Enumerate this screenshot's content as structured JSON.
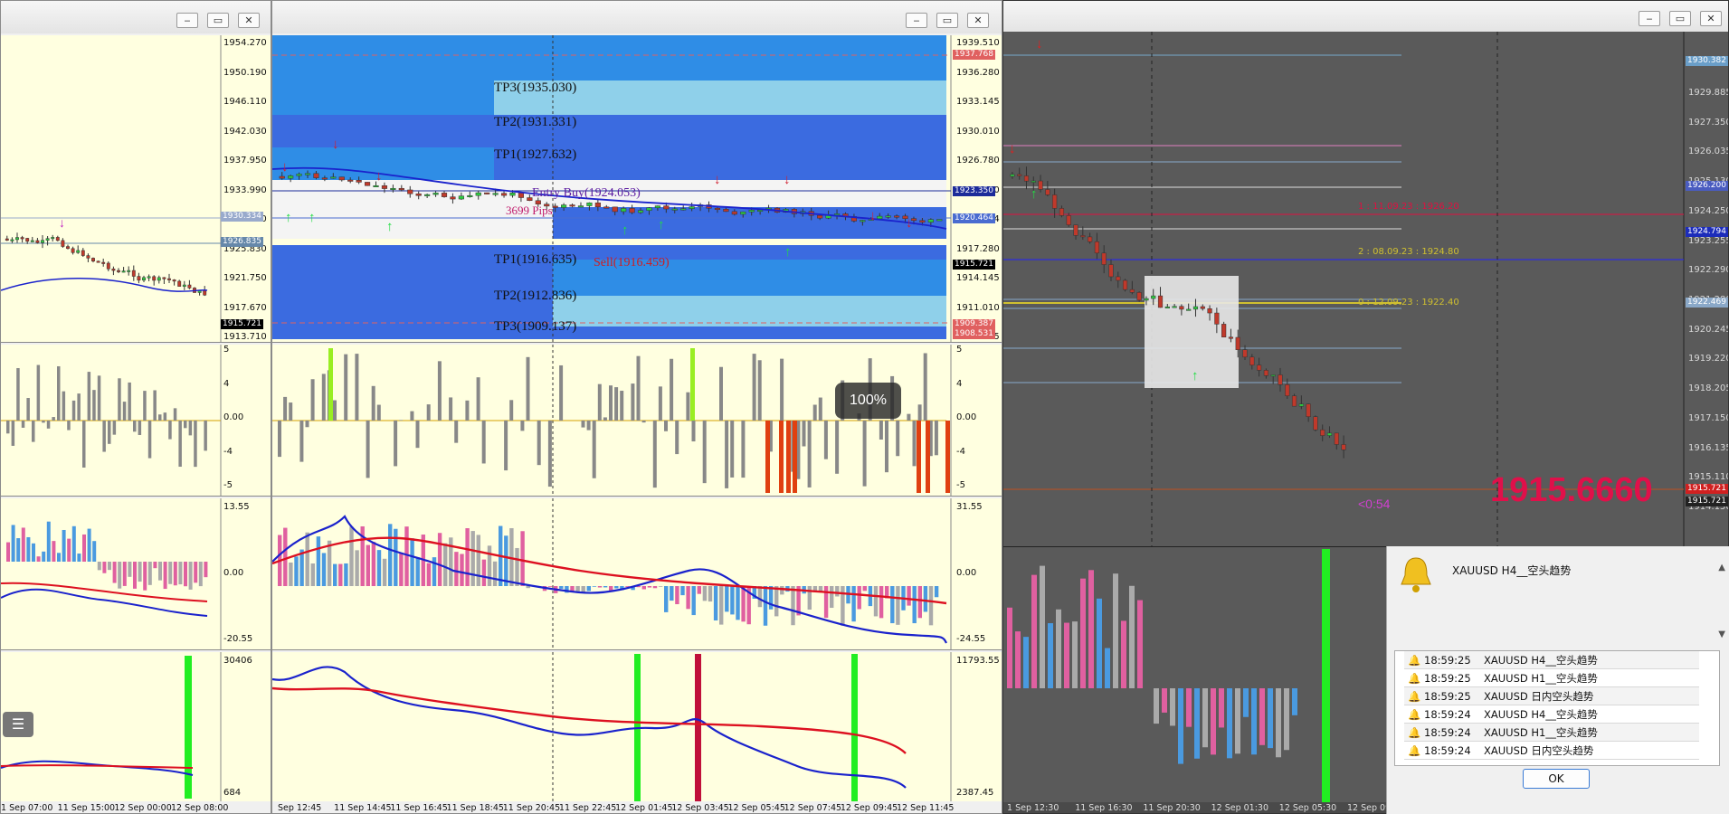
{
  "left_window": {
    "price_axis": [
      "1954.270",
      "1950.190",
      "1946.110",
      "1942.030",
      "1937.950",
      "1933.990",
      "1929.910",
      "1925.830",
      "1921.750",
      "1917.670",
      "1913.710"
    ],
    "tags": {
      "ref1": "1930.334",
      "ref2": "1926.835",
      "current": "1915.721"
    },
    "osc_axis": [
      "5",
      "4",
      "0.00",
      "-4",
      "-5"
    ],
    "macd_axis": [
      "13.55",
      "0.00",
      "-20.55"
    ],
    "vol_axis": [
      "30406",
      "684"
    ],
    "time_axis": [
      "1 Sep 07:00",
      "11 Sep 15:00",
      "12 Sep 00:00",
      "12 Sep 08:00"
    ]
  },
  "middle_window": {
    "price_axis": [
      "1939.510",
      "1936.280",
      "1933.145",
      "1930.010",
      "1926.780",
      "1923.350",
      "1920.464",
      "1917.280",
      "1914.145",
      "1911.010",
      "1907.875"
    ],
    "tags": {
      "t1": "1937.768",
      "t2": "1923.350",
      "t3": "1920.464",
      "t4": "1915.721",
      "t5": "1909.387",
      "t6": "1908.531"
    },
    "tp_labels": [
      "TP3(1935.030)",
      "TP2(1931.331)",
      "TP1(1927.632)",
      "TP1(1916.635)",
      "TP2(1912.836)",
      "TP3(1909.137)"
    ],
    "entry_label": "Entry Buy(1924.053)",
    "sell_label": "Sell(1916.459)",
    "pips_label": "3699 Pips",
    "osc_axis": [
      "5",
      "4",
      "0.00",
      "-4",
      "-5"
    ],
    "macd_axis": [
      "31.55",
      "0.00",
      "-24.55"
    ],
    "vol_axis": [
      "11793.55",
      "2387.45"
    ],
    "time_axis": [
      "Sep 12:45",
      "11 Sep 14:45",
      "11 Sep 16:45",
      "11 Sep 18:45",
      "11 Sep 20:45",
      "11 Sep 22:45",
      "12 Sep 01:45",
      "12 Sep 03:45",
      "12 Sep 05:45",
      "12 Sep 07:45",
      "12 Sep 09:45",
      "12 Sep 11:45"
    ],
    "zoom": "100%"
  },
  "right_window": {
    "price_axis": [
      "1929.885",
      "1927.350",
      "1926.035",
      "1925.130",
      "1924.250",
      "1923.255",
      "1922.290",
      "1921.280",
      "1920.245",
      "1919.220",
      "1918.205",
      "1917.150",
      "1916.135",
      "1915.110",
      "1914.150"
    ],
    "tags": {
      "r1": "1930.382",
      "r2": "1926.200",
      "r3": "1924.794",
      "r4": "1922.469",
      "r5": "1915.721",
      "r6": "1915.721"
    },
    "level_labels": [
      "1 : 11.09.23 : 1926.20",
      "2 : 08.09.23 : 1924.80",
      "0 : 12.09.23 : 1922.40"
    ],
    "big_price": "1915.6660",
    "timer": "<0:54",
    "time_axis": [
      "1 Sep 12:30",
      "11 Sep 16:30",
      "11 Sep 20:30",
      "12 Sep 01:30",
      "12 Sep 05:30",
      "12 Sep 09:30"
    ]
  },
  "alert": {
    "title": "XAUUSD  H4__空头趋势",
    "rows": [
      {
        "time": "18:59:25",
        "msg": "XAUUSD  H4__空头趋势"
      },
      {
        "time": "18:59:25",
        "msg": "XAUUSD  H1__空头趋势"
      },
      {
        "time": "18:59:25",
        "msg": "XAUUSD  日内空头趋势"
      },
      {
        "time": "18:59:24",
        "msg": "XAUUSD  H4__空头趋势"
      },
      {
        "time": "18:59:24",
        "msg": "XAUUSD  H1__空头趋势"
      },
      {
        "time": "18:59:24",
        "msg": "XAUUSD  日内空头趋势"
      }
    ],
    "ok": "OK"
  },
  "colors": {
    "pane_bg": "#ffffe0",
    "dark_bg": "#5a5a5a",
    "bull": "#2ecc40",
    "bear": "#c0392b",
    "blue_ma": "#1a22cc",
    "red_ma": "#dd1020"
  }
}
